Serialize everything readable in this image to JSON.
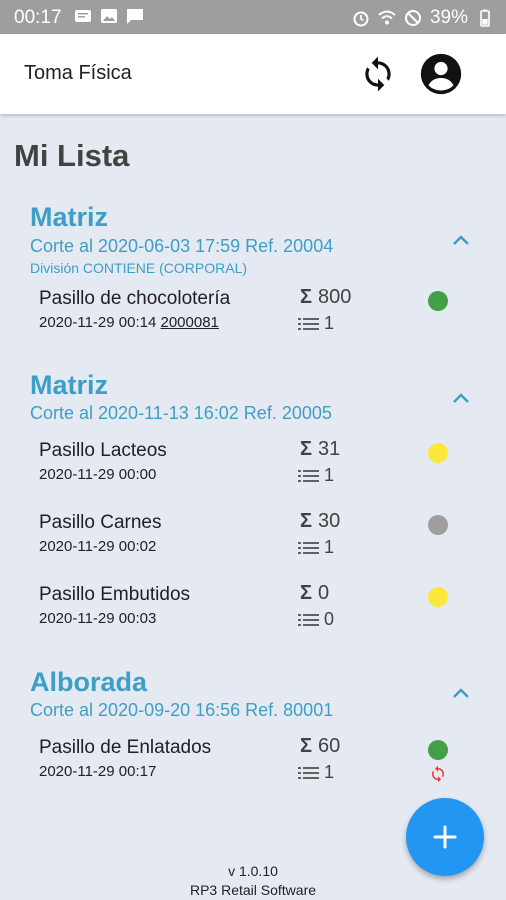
{
  "status_bar": {
    "time": "00:17",
    "battery": "39%"
  },
  "app_bar": {
    "title": "Toma Física"
  },
  "page": {
    "title": "Mi Lista"
  },
  "groups": [
    {
      "name": "Matriz",
      "cut": "Corte al 2020-06-03 17:59 Ref. 20004",
      "division": "División CONTIENE (CORPORAL)",
      "items": [
        {
          "name": "Pasillo de chocolotería",
          "date": "2020-11-29 00:14",
          "ref": "2000081",
          "sum": "800",
          "count": "1",
          "status_color": "#43a047"
        }
      ]
    },
    {
      "name": "Matriz",
      "cut": "Corte al 2020-11-13 16:02 Ref. 20005",
      "items": [
        {
          "name": "Pasillo Lacteos",
          "date": "2020-11-29 00:00",
          "sum": "31",
          "count": "1",
          "status_color": "#fce83a"
        },
        {
          "name": "Pasillo Carnes",
          "date": "2020-11-29 00:02",
          "sum": "30",
          "count": "1",
          "status_color": "#9e9e9e"
        },
        {
          "name": "Pasillo Embutidos",
          "date": "2020-11-29 00:03",
          "sum": "0",
          "count": "0",
          "status_color": "#fce83a"
        }
      ]
    },
    {
      "name": "Alborada",
      "cut": "Corte al 2020-09-20 16:56 Ref. 80001",
      "items": [
        {
          "name": "Pasillo de Enlatados",
          "date": "2020-11-29 00:17",
          "sum": "60",
          "count": "1",
          "status_color": "#43a047",
          "sync_icon_color": "#e53935"
        }
      ]
    }
  ],
  "sum_symbol": "Σ",
  "footer": {
    "version": "v 1.0.10",
    "company": "RP3 Retail Software"
  },
  "colors": {
    "accent": "#3d9ec7",
    "fab": "#2196f3",
    "status_bar": "#9e9e9e",
    "background": "#e5eaf2"
  }
}
